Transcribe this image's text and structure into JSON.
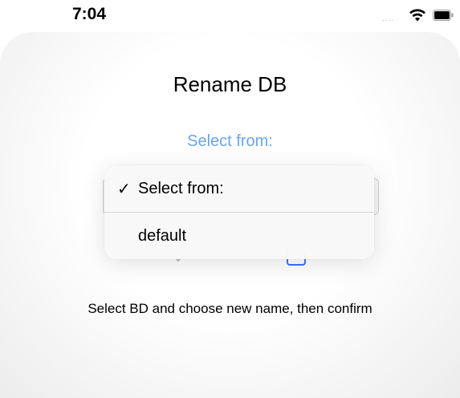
{
  "status_bar": {
    "time": "7:04",
    "signal_dots": "....",
    "icons": [
      "wifi-icon",
      "battery-icon"
    ]
  },
  "header": {
    "title": "Rename DB"
  },
  "form": {
    "select_label": "Select from:",
    "instructions": "Select BD and choose new name, then confirm"
  },
  "dropdown": {
    "selected_index": 0,
    "items": [
      {
        "label": "Select from:",
        "checked": true,
        "check_glyph": "✓"
      },
      {
        "label": "default",
        "checked": false,
        "check_glyph": ""
      }
    ]
  },
  "colors": {
    "accent": "#6ba6e6",
    "text": "#000000",
    "menu_background": "#f8f8f8"
  }
}
